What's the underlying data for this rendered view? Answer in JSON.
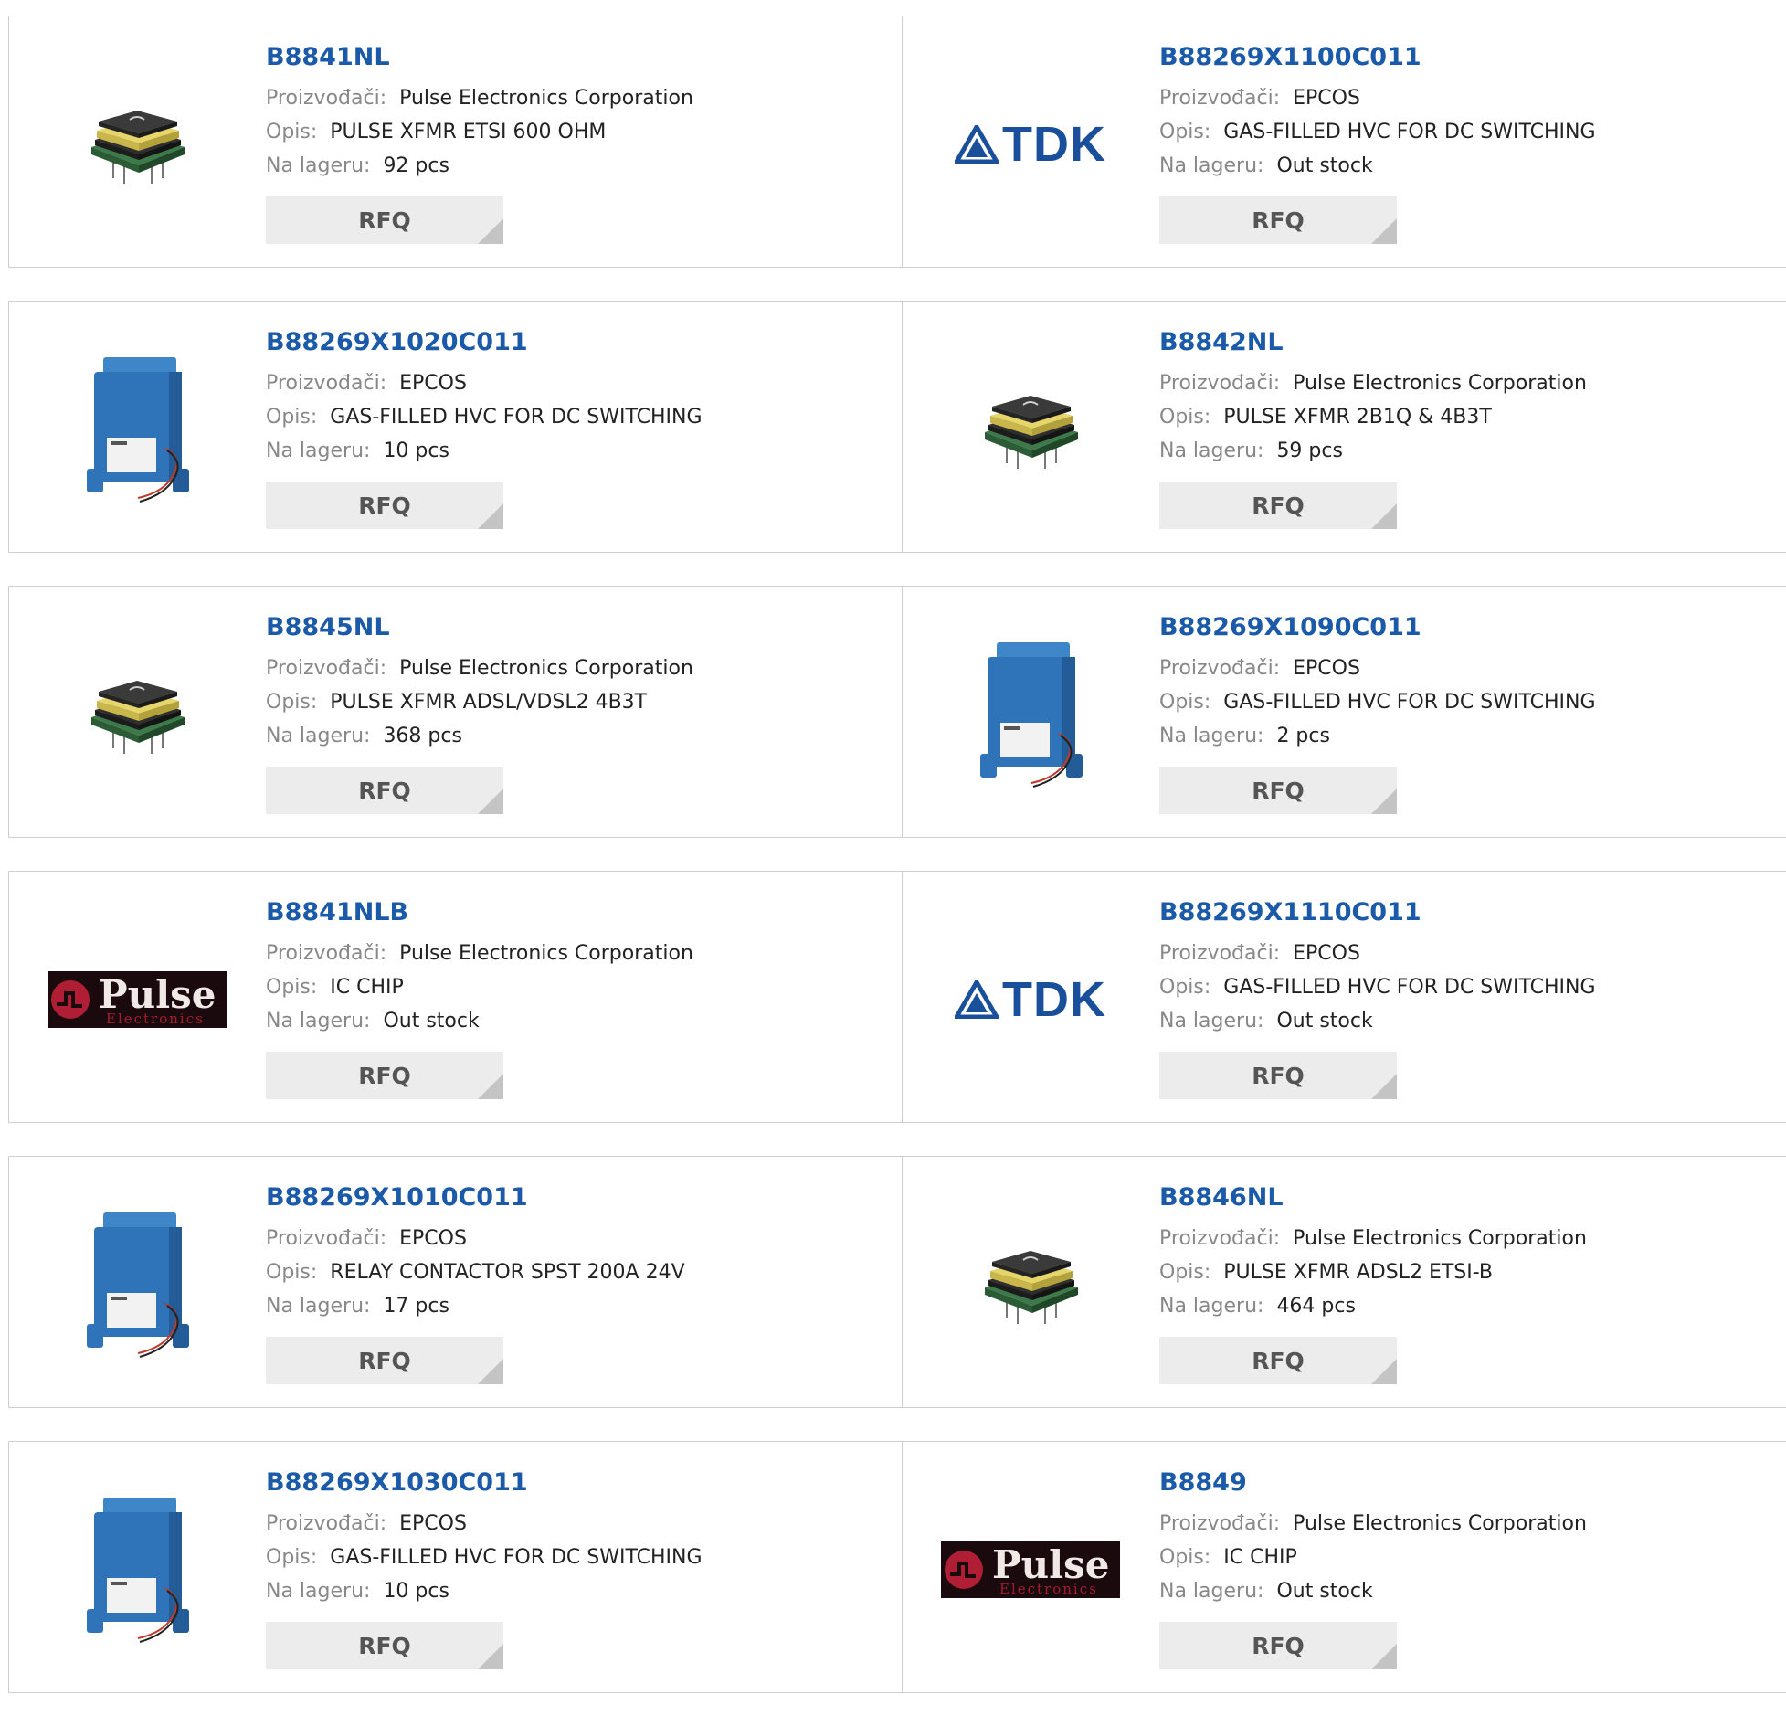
{
  "labels": {
    "manufacturer": "Proizvođači:",
    "description": "Opis:",
    "stock": "Na lageru:",
    "rfq": "RFQ"
  },
  "products": [
    {
      "part": "B8841NL",
      "manufacturer": "Pulse Electronics Corporation",
      "description": "PULSE XFMR ETSI 600 OHM",
      "stock": "92 pcs",
      "image": "smd-transformer-photo"
    },
    {
      "part": "B88269X1100C011",
      "manufacturer": "EPCOS",
      "description": "GAS-FILLED HVC FOR DC SWITCHING",
      "stock": "Out stock",
      "image": "tdk-logo",
      "logo_text": "TDK"
    },
    {
      "part": "B88269X1020C011",
      "manufacturer": "EPCOS",
      "description": "GAS-FILLED HVC FOR DC SWITCHING",
      "stock": "10 pcs",
      "image": "blue-contactor-photo"
    },
    {
      "part": "B8842NL",
      "manufacturer": "Pulse Electronics Corporation",
      "description": "PULSE XFMR 2B1Q & 4B3T",
      "stock": "59 pcs",
      "image": "smd-transformer-photo"
    },
    {
      "part": "B8845NL",
      "manufacturer": "Pulse Electronics Corporation",
      "description": "PULSE XFMR ADSL/VDSL2 4B3T",
      "stock": "368 pcs",
      "image": "smd-transformer-photo"
    },
    {
      "part": "B88269X1090C011",
      "manufacturer": "EPCOS",
      "description": "GAS-FILLED HVC FOR DC SWITCHING",
      "stock": "2 pcs",
      "image": "blue-contactor-photo"
    },
    {
      "part": "B8841NLB",
      "manufacturer": "Pulse Electronics Corporation",
      "description": "IC CHIP",
      "stock": "Out stock",
      "image": "pulse-logo",
      "logo_text": "Pulse",
      "logo_sub": "Electronics"
    },
    {
      "part": "B88269X1110C011",
      "manufacturer": "EPCOS",
      "description": "GAS-FILLED HVC FOR DC SWITCHING",
      "stock": "Out stock",
      "image": "tdk-logo",
      "logo_text": "TDK"
    },
    {
      "part": "B88269X1010C011",
      "manufacturer": "EPCOS",
      "description": "RELAY CONTACTOR SPST 200A 24V",
      "stock": "17 pcs",
      "image": "blue-contactor-photo"
    },
    {
      "part": "B8846NL",
      "manufacturer": "Pulse Electronics Corporation",
      "description": "PULSE XFMR ADSL2 ETSI-B",
      "stock": "464 pcs",
      "image": "smd-transformer-photo"
    },
    {
      "part": "B88269X1030C011",
      "manufacturer": "EPCOS",
      "description": "GAS-FILLED HVC FOR DC SWITCHING",
      "stock": "10 pcs",
      "image": "blue-contactor-photo"
    },
    {
      "part": "B8849",
      "manufacturer": "Pulse Electronics Corporation",
      "description": "IC CHIP",
      "stock": "Out stock",
      "image": "pulse-logo",
      "logo_text": "Pulse",
      "logo_sub": "Electronics"
    }
  ],
  "colors": {
    "part_link": "#1a5aa8",
    "label_gray": "#888888",
    "border": "#cfcfcf",
    "rfq_bg": "#ececec",
    "tdk_blue": "#1a4f9c",
    "pulse_red": "#a61b30"
  }
}
